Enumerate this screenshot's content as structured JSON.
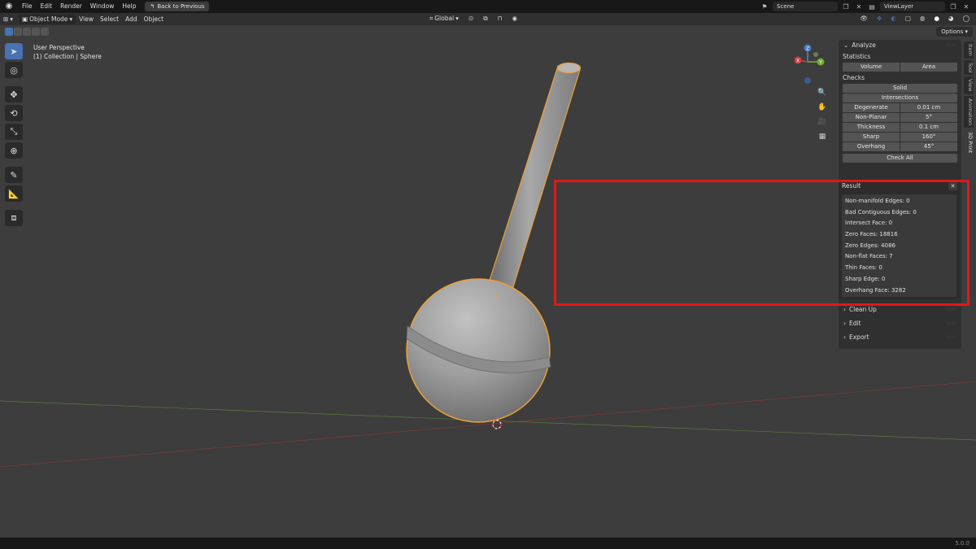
{
  "menu": {
    "items": [
      "File",
      "Edit",
      "Render",
      "Window",
      "Help"
    ],
    "back_button": "Back to Previous",
    "scene": "Scene",
    "view_layer": "ViewLayer"
  },
  "header": {
    "mode": "Object Mode",
    "menus": [
      "View",
      "Select",
      "Add",
      "Object"
    ],
    "orientation": "Global",
    "options": "Options"
  },
  "viewport": {
    "perspective": "User Perspective",
    "object_info": "(1) Collection | Sphere"
  },
  "gizmo": {
    "x": "X",
    "y": "Y",
    "z": "Z"
  },
  "npanel": {
    "analyze": {
      "title": "Analyze",
      "statistics_label": "Statistics",
      "volume": "Volume",
      "area": "Area",
      "checks_label": "Checks",
      "solid": "Solid",
      "intersections": "Intersections",
      "rows": [
        {
          "k": "Degenerate",
          "v": "0.01 cm"
        },
        {
          "k": "Non-Planar",
          "v": "5°"
        },
        {
          "k": "Thickness",
          "v": "0.1 cm"
        },
        {
          "k": "Sharp",
          "v": "160°"
        },
        {
          "k": "Overhang",
          "v": "45°"
        }
      ],
      "check_all": "Check All"
    },
    "result": {
      "title": "Result",
      "lines": [
        "Non-manifold Edges: 0",
        "Bad Contiguous Edges: 0",
        "Intersect Face: 0",
        "Zero Faces: 18816",
        "Zero Edges: 4086",
        "Non-flat Faces: 7",
        "Thin Faces: 0",
        "Sharp Edge: 0",
        "Overhang Face: 3282"
      ]
    },
    "clean_up": "Clean Up",
    "edit": "Edit",
    "export": "Export"
  },
  "side_tabs": [
    "Item",
    "Tool",
    "View",
    "Animation",
    "3D Print"
  ],
  "status": {
    "version": "5.0.0"
  },
  "colors": {
    "accent": "#4772b3",
    "selection_outline": "#f0a030",
    "highlight": "#e01818"
  }
}
